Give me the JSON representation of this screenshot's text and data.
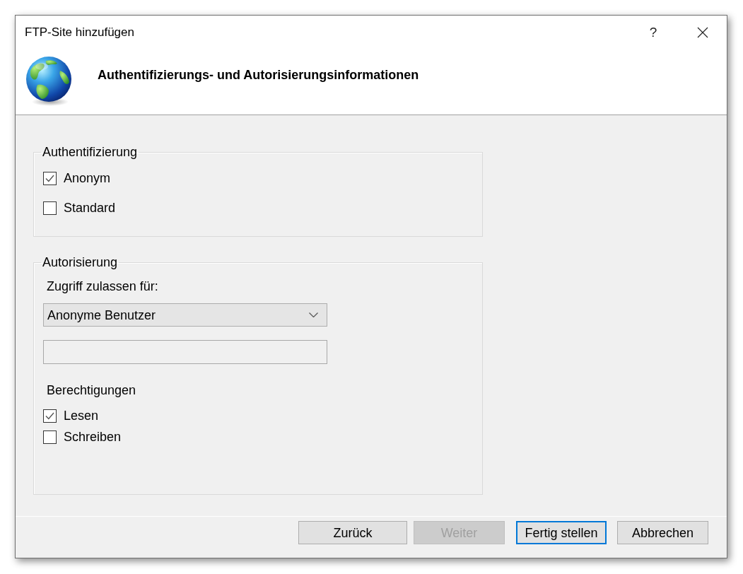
{
  "window": {
    "title": "FTP-Site hinzufügen",
    "help_button": "?"
  },
  "header": {
    "title": "Authentifizierungs- und Autorisierungsinformationen"
  },
  "authentication": {
    "legend": "Authentifizierung",
    "options": [
      {
        "label": "Anonym",
        "checked": true
      },
      {
        "label": "Standard",
        "checked": false
      }
    ]
  },
  "authorization": {
    "legend": "Autorisierung",
    "access_label": "Zugriff zulassen für:",
    "access_select": {
      "value": "Anonyme Benutzer"
    },
    "user_field": {
      "disabled": true
    },
    "permissions_label": "Berechtigungen",
    "permissions": [
      {
        "label": "Lesen",
        "checked": true
      },
      {
        "label": "Schreiben",
        "checked": false
      }
    ]
  },
  "buttons": [
    {
      "label": "Zurück",
      "disabled": false,
      "default": false
    },
    {
      "label": "Weiter",
      "disabled": true,
      "default": false
    },
    {
      "label": "Fertig stellen",
      "disabled": false,
      "default": true
    },
    {
      "label": "Abbrechen",
      "disabled": false,
      "default": false
    }
  ]
}
